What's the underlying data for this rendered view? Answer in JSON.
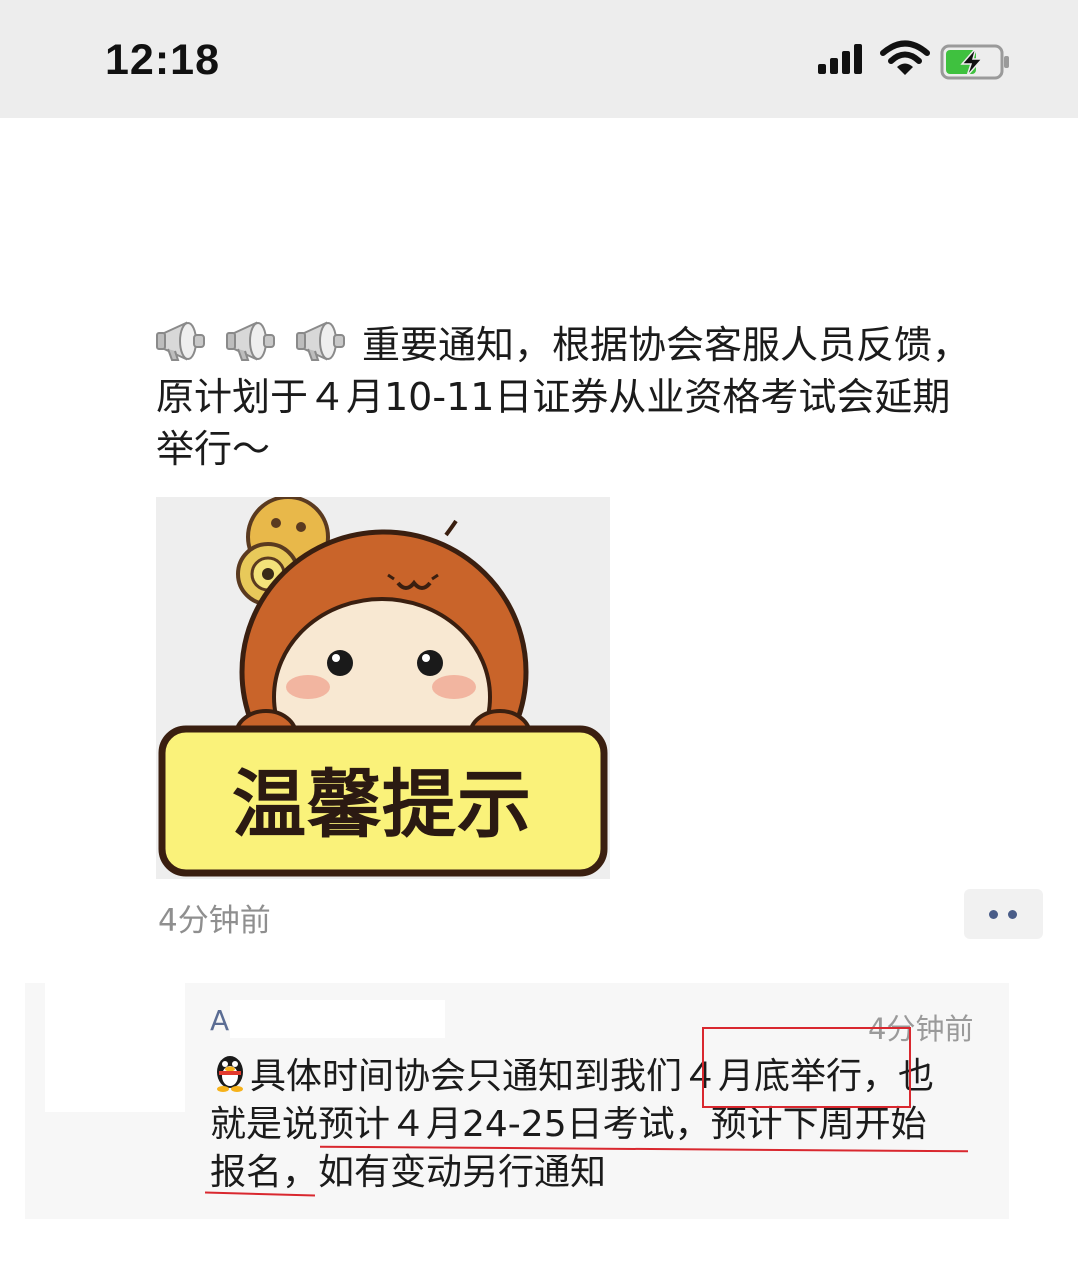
{
  "status_bar": {
    "time": "12:18"
  },
  "post": {
    "lines": [
      "重要通知，根据协会客服人员反馈，",
      "原计划于４月10-11日证券从业资格考试会延期",
      "举行～"
    ],
    "sticker_caption": "温馨提示",
    "timestamp": "4分钟前"
  },
  "comment": {
    "author": "A",
    "time": "4分钟前",
    "lines": [
      "具体时间协会只通知到我们４月底举行，也",
      "就是说预计４月24-25日考试，预计下周开始",
      "报名，如有变动另行通知"
    ]
  },
  "colors": {
    "highlight": "#d9282f",
    "link_blue": "#5a6c93",
    "status_bg": "#ededed"
  }
}
